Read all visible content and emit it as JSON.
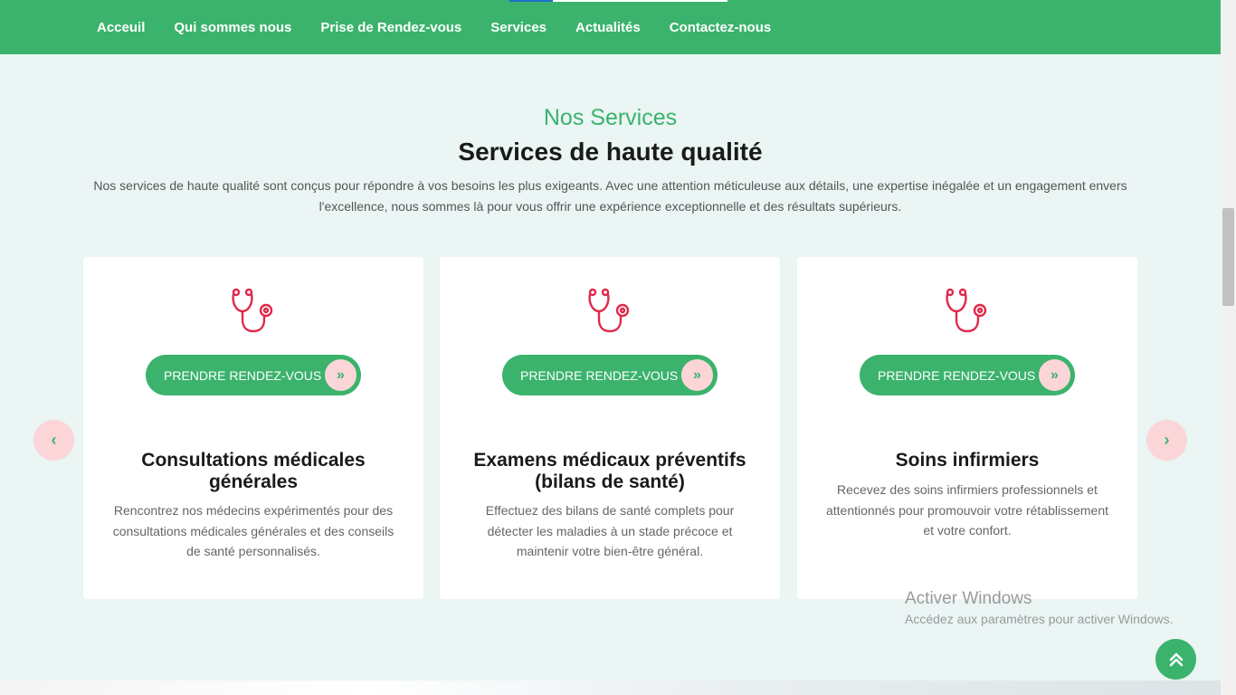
{
  "nav": {
    "items": [
      {
        "label": "Acceuil"
      },
      {
        "label": "Qui sommes nous"
      },
      {
        "label": "Prise de Rendez-vous"
      },
      {
        "label": "Services"
      },
      {
        "label": "Actualités"
      },
      {
        "label": "Contactez-nous"
      }
    ]
  },
  "section": {
    "subtitle": "Nos Services",
    "title": "Services de haute qualité",
    "description": "Nos services de haute qualité sont conçus pour répondre à vos besoins les plus exigeants. Avec une attention méticuleuse aux détails, une expertise inégalée et un engagement envers l'excellence, nous sommes là pour vous offrir une expérience exceptionnelle et des résultats supérieurs."
  },
  "cards": [
    {
      "icon": "stethoscope-icon",
      "button_label": "PRENDRE RENDEZ-VOUS",
      "title": "Consultations médicales générales",
      "description": "Rencontrez nos médecins expérimentés pour des consultations médicales générales et des conseils de santé personnalisés."
    },
    {
      "icon": "stethoscope-icon",
      "button_label": "PRENDRE RENDEZ-VOUS",
      "title": "Examens médicaux préventifs (bilans de santé)",
      "description": "Effectuez des bilans de santé complets pour détecter les maladies à un stade précoce et maintenir votre bien-être général."
    },
    {
      "icon": "stethoscope-icon",
      "button_label": "PRENDRE RENDEZ-VOUS",
      "title": "Soins infirmiers",
      "description": "Recevez des soins infirmiers professionnels et attentionnés pour promouvoir votre rétablissement et votre confort."
    }
  ],
  "carousel": {
    "prev_icon": "chevron-left-icon",
    "next_icon": "chevron-right-icon",
    "prev_glyph": "‹",
    "next_glyph": "›"
  },
  "button_arrow_glyph": "»",
  "watermark": {
    "title": "Activer Windows",
    "subtitle": "Accédez aux paramètres pour activer Windows."
  },
  "back_to_top": {
    "icon": "double-chevron-up-icon",
    "glyph": "⌃"
  },
  "colors": {
    "brand_green": "#3bb36c",
    "accent_pink": "#fbd5d8",
    "icon_red": "#e0294a",
    "background": "#eaf5f4"
  }
}
